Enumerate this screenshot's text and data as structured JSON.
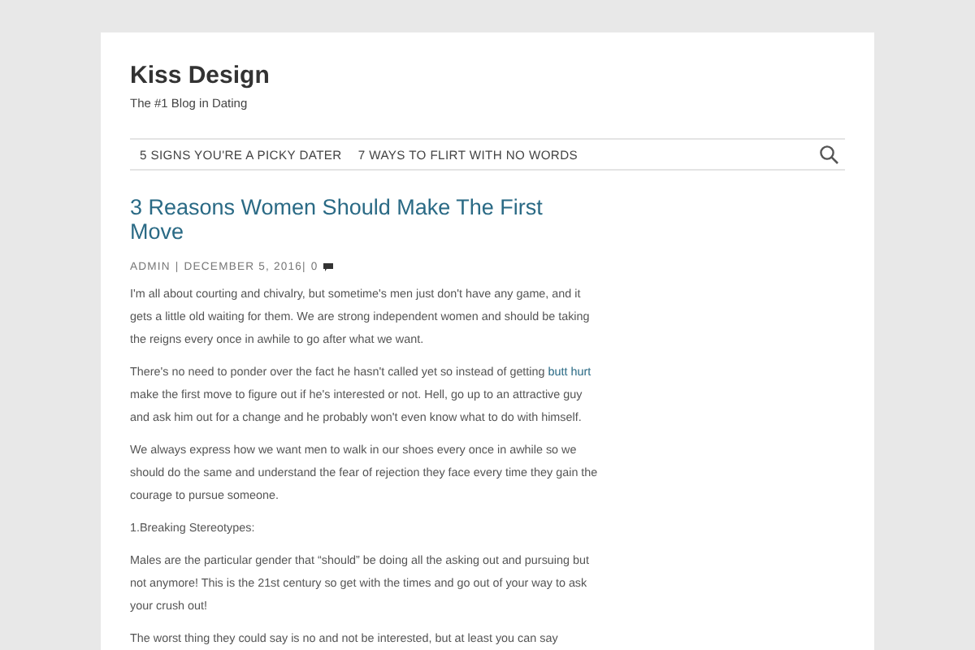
{
  "site": {
    "title": "Kiss Design",
    "tagline": "The #1 Blog in Dating"
  },
  "nav": {
    "items": [
      "5 SIGNS YOU'RE A PICKY DATER",
      "7 WAYS TO FLIRT WITH NO WORDS"
    ]
  },
  "post": {
    "title": "3 Reasons Women Should Make The First Move",
    "meta": {
      "author": "ADMIN",
      "separator": "|",
      "date": "DECEMBER 5, 2016|",
      "comments": "0"
    },
    "paragraphs": [
      {
        "text": "I'm all about courting and chivalry, but sometime's men just don't have any game, and it gets a little old waiting for them. We are strong independent women and should be taking the reigns every once in awhile to go after what we want."
      },
      {
        "text": "There's no need to ponder over the fact he hasn't called yet so instead of getting",
        "link": "butt hurt",
        "after": "make the first move to figure out if he's interested or not. Hell, go up to an attractive guy and ask him out for a change and he probably won't even know what to do with himself."
      },
      {
        "text": "We always express how we want men to walk in our shoes every once in awhile so we should do the same and understand the fear of rejection they face every time they gain the courage to pursue someone."
      },
      {
        "text": "1.Breaking Stereotypes:"
      },
      {
        "text": "Males are the particular gender that “should” be doing all the asking out and pursuing but not anymore! This is the 21st century so get with the times and go out of your way to ask your crush out!"
      },
      {
        "text": "The worst thing they could say is no and not be interested, but at least you can say"
      }
    ]
  }
}
